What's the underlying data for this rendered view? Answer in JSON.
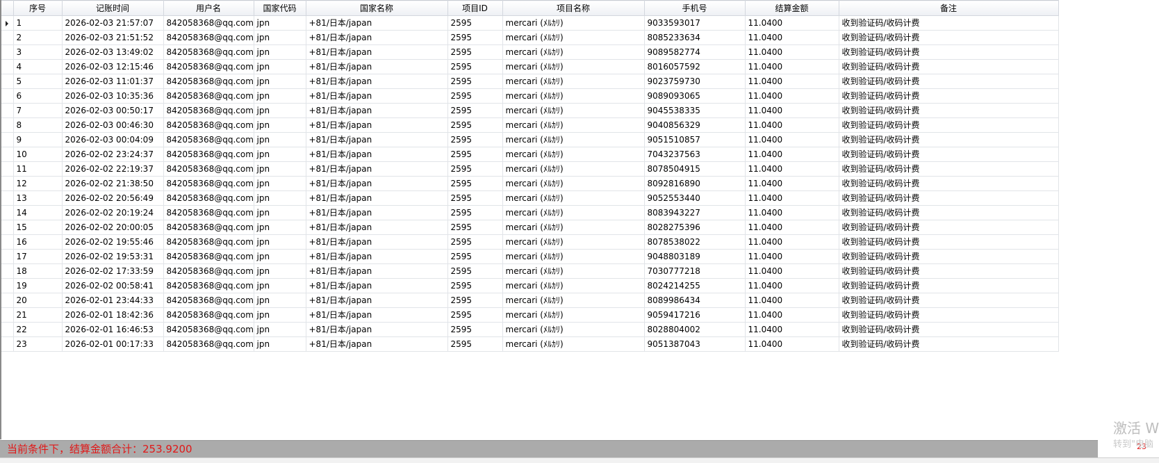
{
  "grid": {
    "columns": [
      "序号",
      "记账时间",
      "用户名",
      "国家代码",
      "国家名称",
      "项目ID",
      "项目名称",
      "手机号",
      "结算金额",
      "备注"
    ],
    "rows": [
      [
        "1",
        "2026-02-03 21:57:07",
        "842058368@qq.com",
        "jpn",
        "+81/日本/japan",
        "2595",
        "mercari (ﾒﾙｶﾘ)",
        "9033593017",
        "11.0400",
        "收到验证码/收码计费"
      ],
      [
        "2",
        "2026-02-03 21:51:52",
        "842058368@qq.com",
        "jpn",
        "+81/日本/japan",
        "2595",
        "mercari (ﾒﾙｶﾘ)",
        "8085233634",
        "11.0400",
        "收到验证码/收码计费"
      ],
      [
        "3",
        "2026-02-03 13:49:02",
        "842058368@qq.com",
        "jpn",
        "+81/日本/japan",
        "2595",
        "mercari (ﾒﾙｶﾘ)",
        "9089582774",
        "11.0400",
        "收到验证码/收码计费"
      ],
      [
        "4",
        "2026-02-03 12:15:46",
        "842058368@qq.com",
        "jpn",
        "+81/日本/japan",
        "2595",
        "mercari (ﾒﾙｶﾘ)",
        "8016057592",
        "11.0400",
        "收到验证码/收码计费"
      ],
      [
        "5",
        "2026-02-03 11:01:37",
        "842058368@qq.com",
        "jpn",
        "+81/日本/japan",
        "2595",
        "mercari (ﾒﾙｶﾘ)",
        "9023759730",
        "11.0400",
        "收到验证码/收码计费"
      ],
      [
        "6",
        "2026-02-03 10:35:36",
        "842058368@qq.com",
        "jpn",
        "+81/日本/japan",
        "2595",
        "mercari (ﾒﾙｶﾘ)",
        "9089093065",
        "11.0400",
        "收到验证码/收码计费"
      ],
      [
        "7",
        "2026-02-03 00:50:17",
        "842058368@qq.com",
        "jpn",
        "+81/日本/japan",
        "2595",
        "mercari (ﾒﾙｶﾘ)",
        "9045538335",
        "11.0400",
        "收到验证码/收码计费"
      ],
      [
        "8",
        "2026-02-03 00:46:30",
        "842058368@qq.com",
        "jpn",
        "+81/日本/japan",
        "2595",
        "mercari (ﾒﾙｶﾘ)",
        "9040856329",
        "11.0400",
        "收到验证码/收码计费"
      ],
      [
        "9",
        "2026-02-03 00:04:09",
        "842058368@qq.com",
        "jpn",
        "+81/日本/japan",
        "2595",
        "mercari (ﾒﾙｶﾘ)",
        "9051510857",
        "11.0400",
        "收到验证码/收码计费"
      ],
      [
        "10",
        "2026-02-02 23:24:37",
        "842058368@qq.com",
        "jpn",
        "+81/日本/japan",
        "2595",
        "mercari (ﾒﾙｶﾘ)",
        "7043237563",
        "11.0400",
        "收到验证码/收码计费"
      ],
      [
        "11",
        "2026-02-02 22:19:37",
        "842058368@qq.com",
        "jpn",
        "+81/日本/japan",
        "2595",
        "mercari (ﾒﾙｶﾘ)",
        "8078504915",
        "11.0400",
        "收到验证码/收码计费"
      ],
      [
        "12",
        "2026-02-02 21:38:50",
        "842058368@qq.com",
        "jpn",
        "+81/日本/japan",
        "2595",
        "mercari (ﾒﾙｶﾘ)",
        "8092816890",
        "11.0400",
        "收到验证码/收码计费"
      ],
      [
        "13",
        "2026-02-02 20:56:49",
        "842058368@qq.com",
        "jpn",
        "+81/日本/japan",
        "2595",
        "mercari (ﾒﾙｶﾘ)",
        "9052553440",
        "11.0400",
        "收到验证码/收码计费"
      ],
      [
        "14",
        "2026-02-02 20:19:24",
        "842058368@qq.com",
        "jpn",
        "+81/日本/japan",
        "2595",
        "mercari (ﾒﾙｶﾘ)",
        "8083943227",
        "11.0400",
        "收到验证码/收码计费"
      ],
      [
        "15",
        "2026-02-02 20:00:05",
        "842058368@qq.com",
        "jpn",
        "+81/日本/japan",
        "2595",
        "mercari (ﾒﾙｶﾘ)",
        "8028275396",
        "11.0400",
        "收到验证码/收码计费"
      ],
      [
        "16",
        "2026-02-02 19:55:46",
        "842058368@qq.com",
        "jpn",
        "+81/日本/japan",
        "2595",
        "mercari (ﾒﾙｶﾘ)",
        "8078538022",
        "11.0400",
        "收到验证码/收码计费"
      ],
      [
        "17",
        "2026-02-02 19:53:31",
        "842058368@qq.com",
        "jpn",
        "+81/日本/japan",
        "2595",
        "mercari (ﾒﾙｶﾘ)",
        "9048803189",
        "11.0400",
        "收到验证码/收码计费"
      ],
      [
        "18",
        "2026-02-02 17:33:59",
        "842058368@qq.com",
        "jpn",
        "+81/日本/japan",
        "2595",
        "mercari (ﾒﾙｶﾘ)",
        "7030777218",
        "11.0400",
        "收到验证码/收码计费"
      ],
      [
        "19",
        "2026-02-02 00:58:41",
        "842058368@qq.com",
        "jpn",
        "+81/日本/japan",
        "2595",
        "mercari (ﾒﾙｶﾘ)",
        "8024214255",
        "11.0400",
        "收到验证码/收码计费"
      ],
      [
        "20",
        "2026-02-01 23:44:33",
        "842058368@qq.com",
        "jpn",
        "+81/日本/japan",
        "2595",
        "mercari (ﾒﾙｶﾘ)",
        "8089986434",
        "11.0400",
        "收到验证码/收码计费"
      ],
      [
        "21",
        "2026-02-01 18:42:36",
        "842058368@qq.com",
        "jpn",
        "+81/日本/japan",
        "2595",
        "mercari (ﾒﾙｶﾘ)",
        "9059417216",
        "11.0400",
        "收到验证码/收码计费"
      ],
      [
        "22",
        "2026-02-01 16:46:53",
        "842058368@qq.com",
        "jpn",
        "+81/日本/japan",
        "2595",
        "mercari (ﾒﾙｶﾘ)",
        "8028804002",
        "11.0400",
        "收到验证码/收码计费"
      ],
      [
        "23",
        "2026-02-01 00:17:33",
        "842058368@qq.com",
        "jpn",
        "+81/日本/japan",
        "2595",
        "mercari (ﾒﾙｶﾘ)",
        "9051387043",
        "11.0400",
        "收到验证码/收码计费"
      ]
    ],
    "current_row": 0,
    "current_row_icon": "row-pointer-icon"
  },
  "status_bar": {
    "total_text": "当前条件下，结算金额合计：253.9200",
    "text_color": "#e01818",
    "page_count": "23"
  },
  "watermark": {
    "line1": "激活 W",
    "line2": "转到\"电脑"
  },
  "colors": {
    "status_bar_bg": "#ababab",
    "header_bg": "#eef0f4",
    "grid_line": "#e1e4e8"
  }
}
